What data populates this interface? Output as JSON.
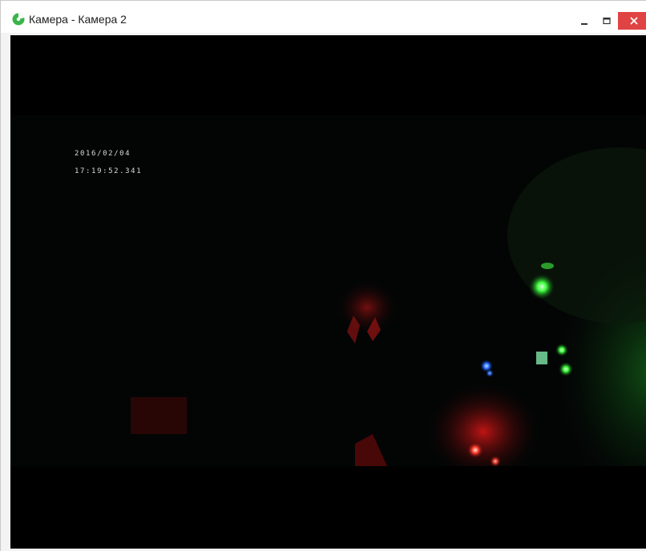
{
  "window": {
    "title": "Камера - Камера 2",
    "icon": "camera-app-icon",
    "controls": {
      "minimize_icon": "minimize-icon",
      "maximize_icon": "maximize-icon",
      "close_icon": "close-icon",
      "close_color": "#e04343"
    }
  },
  "video": {
    "osd_date": "2016/02/04",
    "osd_time": "17:19:52.341"
  }
}
